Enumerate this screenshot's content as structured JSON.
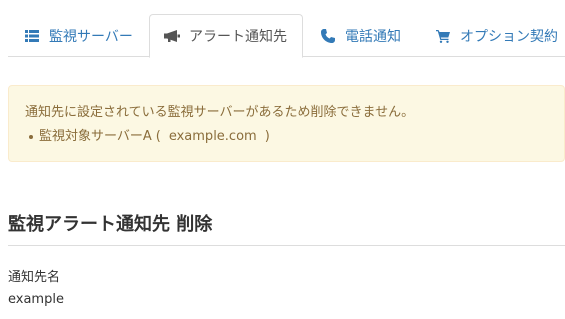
{
  "tabs": [
    {
      "label": "監視サーバー",
      "icon": "list-icon",
      "active": false
    },
    {
      "label": "アラート通知先",
      "icon": "megaphone-icon",
      "active": true
    },
    {
      "label": "電話通知",
      "icon": "phone-icon",
      "active": false
    },
    {
      "label": "オプション契約",
      "icon": "cart-icon",
      "active": false
    }
  ],
  "alert": {
    "message": "通知先に設定されている監視サーバーがあるため削除できません。",
    "item_name": "監視対象サーバーA",
    "item_open": "(",
    "item_domain": "example.com",
    "item_close": ")"
  },
  "page": {
    "title": "監視アラート通知先 削除"
  },
  "field": {
    "label": "通知先名",
    "value": "example"
  },
  "colors": {
    "link": "#337ab7",
    "alert_bg": "#fcf8e3",
    "alert_text": "#8a6d3b",
    "border": "#dddddd"
  }
}
